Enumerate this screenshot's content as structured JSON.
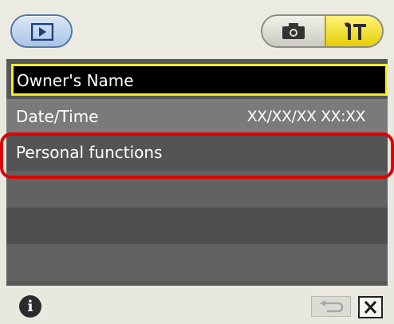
{
  "header": {
    "playback_icon": "play-icon",
    "camera_icon": "camera-icon",
    "setup_icon": "setup-tools-icon",
    "active_tab": "setup"
  },
  "menu": {
    "items": [
      {
        "label": "Owner's Name",
        "value": "",
        "state": "selected"
      },
      {
        "label": "Date/Time",
        "value": "XX/XX/XX XX:XX",
        "state": "normal"
      },
      {
        "label": "Personal functions",
        "value": "",
        "state": "highlighted"
      }
    ],
    "empty_rows": 3
  },
  "footer": {
    "info_label": "i",
    "back_icon": "return-icon",
    "close_icon": "close-icon"
  },
  "colors": {
    "selection_border": "#f3ec1f",
    "highlight_ring": "#e00000",
    "setup_tab": "#f5e23a",
    "playback_button": "#b9d0ee"
  }
}
